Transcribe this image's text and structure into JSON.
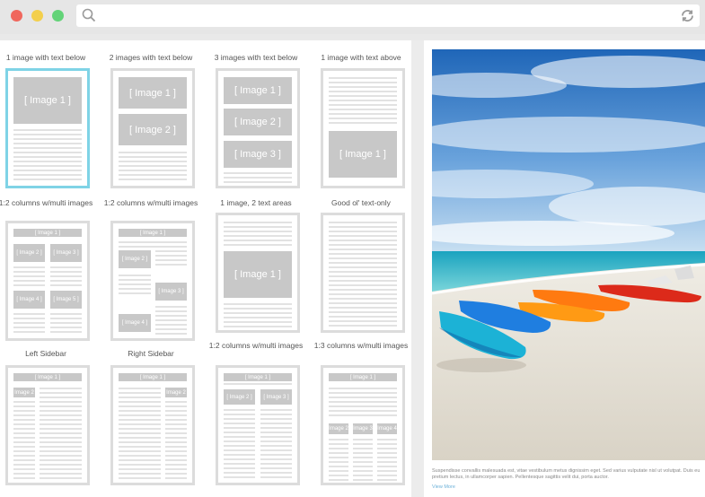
{
  "window": {
    "controls": {
      "close_color": "#f0675d",
      "minimize_color": "#f3cf4c",
      "maximize_color": "#63d378"
    }
  },
  "address_bar": {
    "value": "",
    "search_icon": "search-icon",
    "refresh_icon": "refresh-icon"
  },
  "templates": [
    {
      "label": "1 image with text below",
      "images": [
        "[ Image 1 ]"
      ],
      "selected": true
    },
    {
      "label": "2 images with text below",
      "images": [
        "[ Image 1 ]",
        "[ Image 2 ]"
      ]
    },
    {
      "label": "3 images with text below",
      "images": [
        "[ Image 1 ]",
        "[ Image 2 ]",
        "[ Image 3 ]"
      ]
    },
    {
      "label": "1 image with text above",
      "images": [
        "[ Image 1 ]"
      ]
    },
    {
      "label": "1:2 columns w/multi images",
      "images": [
        "[ Image 1 ]",
        "[ Image 2 ]",
        "[ Image 3 ]",
        "[ Image 4 ]",
        "[ Image 5 ]"
      ]
    },
    {
      "label": "1:2 columns w/multi images",
      "images": [
        "[ Image 1 ]",
        "[ Image 2 ]",
        "[ Image 3 ]",
        "[ Image 4 ]"
      ]
    },
    {
      "label": "1 image, 2 text areas",
      "images": [
        "[ Image 1 ]"
      ]
    },
    {
      "label": "Good ol' text-only",
      "images": []
    },
    {
      "label": "Left Sidebar",
      "images": [
        "[ Image 1 ]",
        "[ Image 2 ]"
      ]
    },
    {
      "label": "Right Sidebar",
      "images": [
        "[ Image 1 ]",
        "[ Image 2 ]"
      ]
    },
    {
      "label": "1:2 columns w/multi images",
      "images": [
        "[ Image 1 ]",
        "[ Image 2 ]",
        "[ Image 3 ]"
      ]
    },
    {
      "label": "1:3 columns w/multi images",
      "images": [
        "[ Image 1 ]",
        "[ Image 2 ]",
        "[ Image 3 ]",
        "[ Image 4 ]"
      ]
    }
  ],
  "preview": {
    "caption": "Suspendisse convallis malesuada est, vitae vestibulum metus dignissim eget. Sed varius vulputate nisl ut volutpat. Duis eu pretium lectus, in ullamcorper sapien. Pellentesque sagittis velit dui, porta auctor.",
    "link": "View More"
  }
}
